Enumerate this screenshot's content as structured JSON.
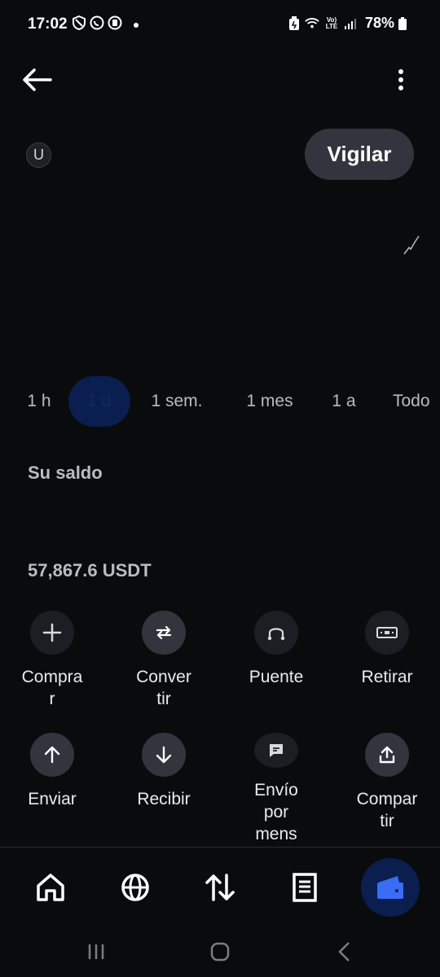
{
  "status_bar": {
    "time": "17:02",
    "battery_percent": "78%",
    "left_icons": [
      "shield-icon",
      "whatsapp-icon",
      "vpn-icon"
    ],
    "right_icons": [
      "battery-saver-icon",
      "wifi-icon",
      "volte-icon",
      "signal-icon",
      "battery-icon"
    ]
  },
  "header": {
    "back_icon": "arrow-left-icon",
    "menu_icon": "more-vertical-icon"
  },
  "token": {
    "avatar_letter": "U",
    "watch_label": "Vigilar"
  },
  "range_tabs": [
    {
      "label": "1 h",
      "active": false
    },
    {
      "label": "1 d",
      "active": true
    },
    {
      "label": "1 sem.",
      "active": false
    },
    {
      "label": "1 mes",
      "active": false
    },
    {
      "label": "1 a",
      "active": false
    },
    {
      "label": "Todo",
      "active": false
    }
  ],
  "balance": {
    "label": "Su saldo",
    "value": "57,867.6 USDT"
  },
  "actions": [
    {
      "label": "Compra\nr",
      "icon": "plus-icon",
      "dim": true
    },
    {
      "label": "Conver\ntir",
      "icon": "convert-icon",
      "dim": false
    },
    {
      "label": "Puente",
      "icon": "bridge-icon",
      "dim": true
    },
    {
      "label": "Retirar",
      "icon": "cash-icon",
      "dim": true
    },
    {
      "label": "Enviar",
      "icon": "arrow-up-icon",
      "dim": false
    },
    {
      "label": "Recibir",
      "icon": "arrow-down-icon",
      "dim": false
    },
    {
      "label": "Envío\npor\nmens",
      "icon": "message-icon",
      "dim": true
    },
    {
      "label": "Compar\ntir",
      "icon": "share-icon",
      "dim": false
    }
  ],
  "bottom_nav": [
    {
      "icon": "home-icon",
      "active": false
    },
    {
      "icon": "globe-icon",
      "active": false
    },
    {
      "icon": "transfer-icon",
      "active": false
    },
    {
      "icon": "document-icon",
      "active": false
    },
    {
      "icon": "wallet-icon",
      "active": true
    }
  ],
  "colors": {
    "background": "#0a0b0d",
    "accent": "#0a1f4f",
    "wallet_blue": "#3a6cf4",
    "button_bg": "#32353d"
  }
}
